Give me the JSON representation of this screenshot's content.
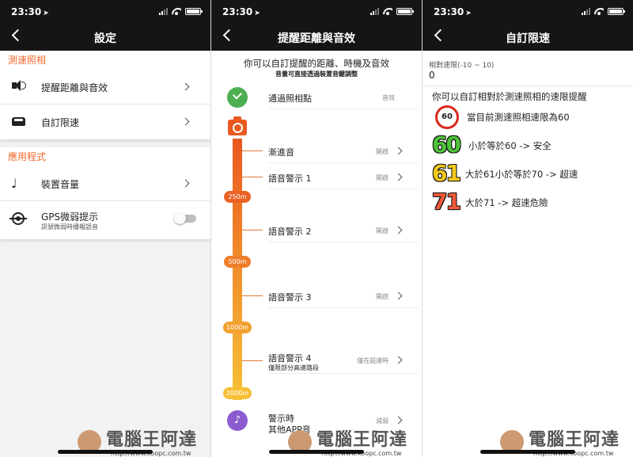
{
  "status": {
    "time": "23:30",
    "location_icon": "location-arrow-icon"
  },
  "screens": [
    {
      "title": "設定",
      "sections": [
        {
          "title": "測速照相",
          "items": [
            {
              "icon": "volume-icon",
              "label": "提醒距離與音效"
            },
            {
              "icon": "car-icon",
              "label": "自訂限速"
            }
          ]
        },
        {
          "title": "應用程式",
          "items": [
            {
              "icon": "music-note-icon",
              "label": "裝置音量"
            },
            {
              "icon": "gps-icon",
              "label": "GPS微弱提示",
              "sub": "訊號微弱時播報語音",
              "toggle": false
            }
          ]
        }
      ]
    },
    {
      "title": "提醒距離與音效",
      "intro": "你可以自訂提醒的距離、時機及音效",
      "intro_sub": "音量可直接透過裝置音鍵調整",
      "rows": [
        {
          "label": "通過照相點",
          "value": "音效"
        },
        {
          "label": "漸進音",
          "value": "開啟"
        },
        {
          "label": "語音警示 1",
          "value": "開啟"
        },
        {
          "label": "語音警示 2",
          "value": "開啟"
        },
        {
          "label": "語音警示 3",
          "value": "開啟"
        },
        {
          "label": "語音警示 4",
          "sub": "僅限部分高速路段",
          "value": "僅在超速時"
        },
        {
          "label": "警示時",
          "sub": "其他APP音",
          "value": "減弱"
        }
      ],
      "distances": [
        "250m",
        "500m",
        "1000m",
        "2000m"
      ]
    },
    {
      "title": "自訂限速",
      "range_label": "相對速限(-10 ~ 10)",
      "range_value": "0",
      "hint": "你可以自訂相對於測速照相的速限提醒",
      "legend": [
        {
          "badge": "60",
          "text": "當目前測速照相速限為60"
        },
        {
          "badge": "60",
          "text": "小於等於60 -> 安全",
          "color": "#4fc33b"
        },
        {
          "badge": "61",
          "text": "大於61小於等於70 -> 超速",
          "color": "#f3c91a"
        },
        {
          "badge": "71",
          "text": "大於71 -> 超速危險",
          "color": "#ef5a3a"
        }
      ]
    }
  ],
  "watermark": {
    "text": "電腦王阿達",
    "url": "http://www.koopc.com.tw"
  },
  "colors": {
    "accent": "#ef6a2c",
    "topbar": "#151515",
    "check": "#4caf50",
    "music": "#8c5bd0"
  }
}
